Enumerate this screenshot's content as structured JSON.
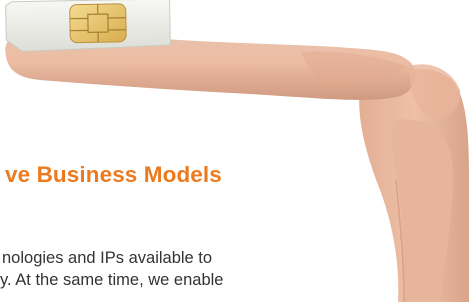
{
  "headline": {
    "text": "ve Business Models",
    "color": "#ec7a1e"
  },
  "body": {
    "lines": [
      "nologies and IPs available to",
      "y. At the same time, we enable"
    ],
    "color": "#333333"
  },
  "photo": {
    "subject": "hand balancing a SIM card on an index finger",
    "sim_card_color": "#f2f3ee",
    "chip_color": "#e9c870",
    "skin_color": "#e7b9a0"
  }
}
